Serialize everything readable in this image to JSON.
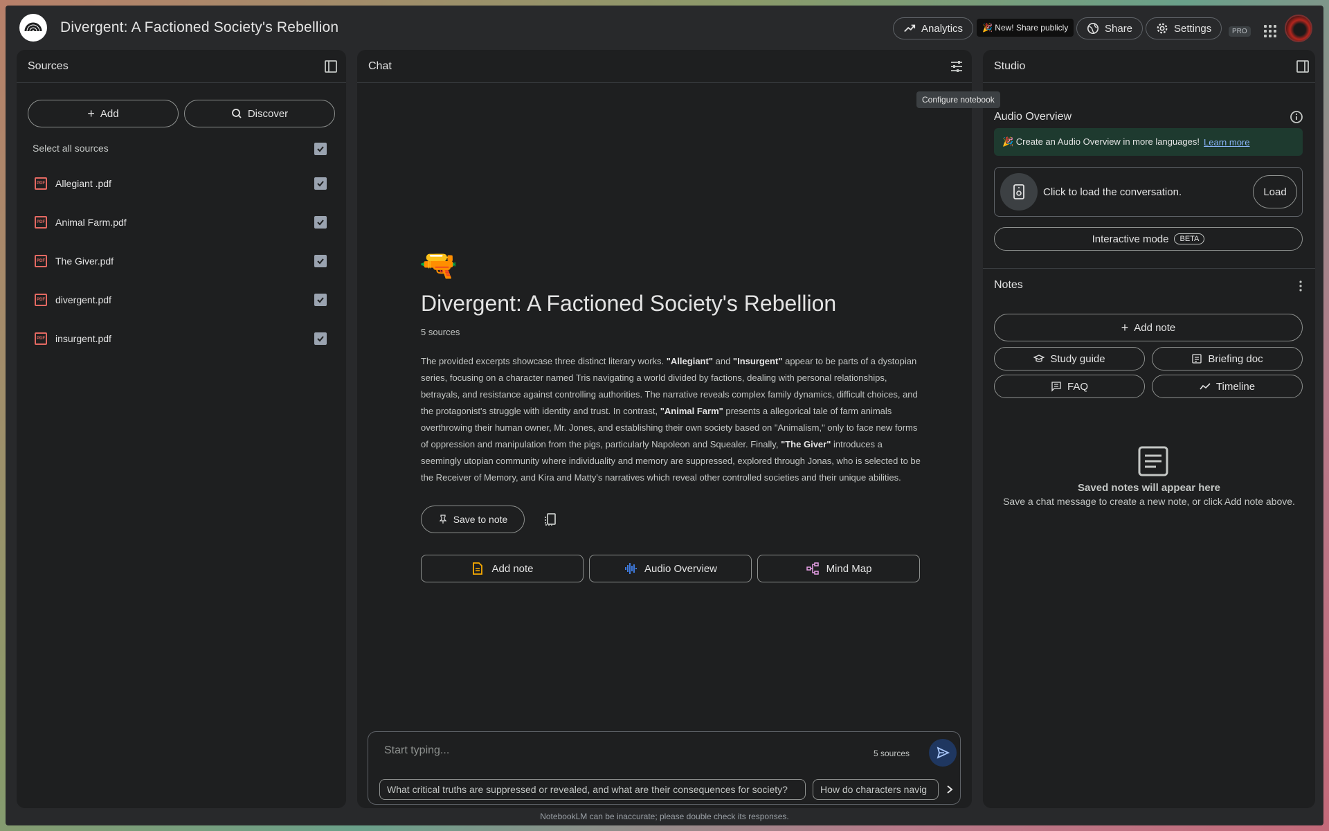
{
  "header": {
    "title": "Divergent: A Factioned Society's Rebellion",
    "analytics_label": "Analytics",
    "new_badge": "🎉 New! Share publicly",
    "share_label": "Share",
    "settings_label": "Settings",
    "pro_label": "PRO"
  },
  "sources": {
    "panel_title": "Sources",
    "add_label": "Add",
    "discover_label": "Discover",
    "select_all_label": "Select all sources",
    "items": [
      {
        "name": "Allegiant .pdf",
        "checked": true
      },
      {
        "name": "Animal Farm.pdf",
        "checked": true
      },
      {
        "name": "The Giver.pdf",
        "checked": true
      },
      {
        "name": "divergent.pdf",
        "checked": true
      },
      {
        "name": "insurgent.pdf",
        "checked": true
      }
    ],
    "pdf_icon_label": "PDF"
  },
  "chat": {
    "panel_title": "Chat",
    "tooltip": "Configure notebook",
    "emoji": "🔫",
    "notebook_title": "Divergent: A Factioned Society's Rebellion",
    "source_count": "5 sources",
    "summary": {
      "p1": "The provided excerpts showcase three distinct literary works. ",
      "b1": "\"Allegiant\"",
      "p2": " and ",
      "b2": "\"Insurgent\"",
      "p3": " appear to be parts of a dystopian series, focusing on a character named Tris navigating a world divided by factions, dealing with personal relationships, betrayals, and resistance against controlling authorities. The narrative reveals complex family dynamics, difficult choices, and the protagonist's struggle with identity and trust. In contrast, ",
      "b3": "\"Animal Farm\"",
      "p4": " presents a allegorical tale of farm animals overthrowing their human owner, Mr. Jones, and establishing their own society based on \"Animalism,\" only to face new forms of oppression and manipulation from the pigs, particularly Napoleon and Squealer. Finally, ",
      "b4": "\"The Giver\"",
      "p5": " introduces a seemingly utopian community where individuality and memory are suppressed, explored through Jonas, who is selected to be the Receiver of Memory, and Kira and Matty's narratives which reveal other controlled societies and their unique abilities."
    },
    "save_to_note_label": "Save to note",
    "actions": [
      {
        "label": "Add note",
        "icon": "note-icon"
      },
      {
        "label": "Audio Overview",
        "icon": "audio-wave-icon"
      },
      {
        "label": "Mind Map",
        "icon": "mind-map-icon"
      }
    ],
    "input": {
      "placeholder": "Start typing...",
      "source_count": "5 sources"
    },
    "suggestions": [
      "What critical truths are suppressed or revealed, and what are their consequences for society?",
      "How do characters navig"
    ],
    "footer_note": "NotebookLM can be inaccurate; please double check its responses."
  },
  "studio": {
    "panel_title": "Studio",
    "audio_overview_title": "Audio Overview",
    "banner_text": "🎉 Create an Audio Overview in more languages!",
    "banner_link": "Learn more",
    "audio_card_text": "Click to load the conversation.",
    "load_label": "Load",
    "interactive_label": "Interactive mode",
    "beta_label": "BETA",
    "notes_title": "Notes",
    "add_note_label": "Add note",
    "note_buttons": [
      {
        "label": "Study guide",
        "icon": "graduation-cap-icon"
      },
      {
        "label": "Briefing doc",
        "icon": "briefing-doc-icon"
      },
      {
        "label": "FAQ",
        "icon": "faq-icon"
      },
      {
        "label": "Timeline",
        "icon": "timeline-icon"
      }
    ],
    "empty_title": "Saved notes will appear here",
    "empty_subtitle": "Save a chat message to create a new note, or click Add note above."
  },
  "colors": {
    "background": "#28292b",
    "panel": "#1e1f20",
    "accent_blue": "#a8c7fa",
    "pdf_red": "#e46962",
    "link_blue": "#8ab4f8",
    "banner_green": "#1e3a2f"
  }
}
